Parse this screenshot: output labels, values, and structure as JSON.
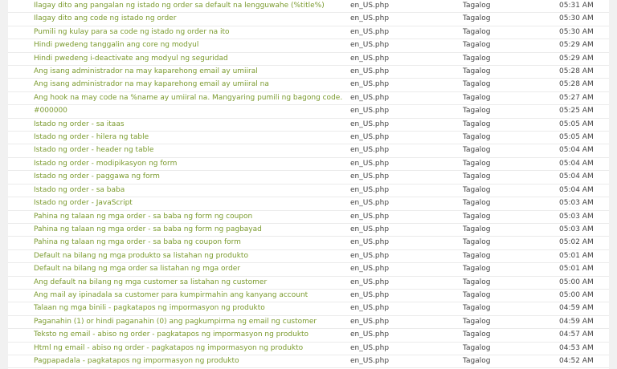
{
  "rows": [
    {
      "text": "Ilagay dito ang pangalan ng istado ng order sa default na lengguwahe (%title%)",
      "file": "en_US.php",
      "language": "Tagalog",
      "time": "05:31 AM"
    },
    {
      "text": "Ilagay dito ang code ng istado ng order",
      "file": "en_US.php",
      "language": "Tagalog",
      "time": "05:30 AM"
    },
    {
      "text": "Pumili ng kulay para sa code ng istado ng order na ito",
      "file": "en_US.php",
      "language": "Tagalog",
      "time": "05:30 AM"
    },
    {
      "text": "Hindi pwedeng tanggalin ang core ng modyul",
      "file": "en_US.php",
      "language": "Tagalog",
      "time": "05:29 AM"
    },
    {
      "text": "Hindi pwedeng i-deactivate ang modyul ng seguridad",
      "file": "en_US.php",
      "language": "Tagalog",
      "time": "05:29 AM"
    },
    {
      "text": "Ang isang administrador na may kaparehong email ay umiiral",
      "file": "en_US.php",
      "language": "Tagalog",
      "time": "05:28 AM"
    },
    {
      "text": "Ang isang administrador na may kaparehong email ay umiiral na",
      "file": "en_US.php",
      "language": "Tagalog",
      "time": "05:28 AM"
    },
    {
      "text": "Ang hook na may code na %name ay umiiral na. Mangyaring pumili ng bagong code.",
      "file": "en_US.php",
      "language": "Tagalog",
      "time": "05:27 AM"
    },
    {
      "text": "#000000",
      "file": "en_US.php",
      "language": "Tagalog",
      "time": "05:25 AM"
    },
    {
      "text": "Istado ng order - sa itaas",
      "file": "en_US.php",
      "language": "Tagalog",
      "time": "05:05 AM"
    },
    {
      "text": "Istado ng order - hilera ng table",
      "file": "en_US.php",
      "language": "Tagalog",
      "time": "05:05 AM"
    },
    {
      "text": "Istado ng order - header ng table",
      "file": "en_US.php",
      "language": "Tagalog",
      "time": "05:04 AM"
    },
    {
      "text": "Istado ng order - modipikasyon ng form",
      "file": "en_US.php",
      "language": "Tagalog",
      "time": "05:04 AM"
    },
    {
      "text": "Istado ng order - paggawa ng form",
      "file": "en_US.php",
      "language": "Tagalog",
      "time": "05:04 AM"
    },
    {
      "text": "Istado ng order - sa baba",
      "file": "en_US.php",
      "language": "Tagalog",
      "time": "05:04 AM"
    },
    {
      "text": "Istado ng order - JavaScript",
      "file": "en_US.php",
      "language": "Tagalog",
      "time": "05:03 AM"
    },
    {
      "text": "Pahina ng talaan ng mga order - sa baba ng form ng coupon",
      "file": "en_US.php",
      "language": "Tagalog",
      "time": "05:03 AM"
    },
    {
      "text": "Pahina ng talaan ng mga order - sa baba ng form ng pagbayad",
      "file": "en_US.php",
      "language": "Tagalog",
      "time": "05:03 AM"
    },
    {
      "text": "Pahina ng talaan ng mga order - sa baba ng coupon form",
      "file": "en_US.php",
      "language": "Tagalog",
      "time": "05:02 AM"
    },
    {
      "text": "Default na bilang ng mga produkto sa listahan ng produkto",
      "file": "en_US.php",
      "language": "Tagalog",
      "time": "05:01 AM"
    },
    {
      "text": "Default na bilang ng mga order sa listahan ng mga order",
      "file": "en_US.php",
      "language": "Tagalog",
      "time": "05:01 AM"
    },
    {
      "text": "Ang default na bilang ng mga customer sa listahan ng customer",
      "file": "en_US.php",
      "language": "Tagalog",
      "time": "05:00 AM"
    },
    {
      "text": "Ang mail ay ipinadala sa customer para kumpirmahin ang kanyang account",
      "file": "en_US.php",
      "language": "Tagalog",
      "time": "05:00 AM"
    },
    {
      "text": "Talaan ng mga binili - pagkatapos ng impormasyon ng produkto",
      "file": "en_US.php",
      "language": "Tagalog",
      "time": "04:59 AM"
    },
    {
      "text": "Paganahin (1) or hindi paganahin (0) ang pagkumpirma ng email ng customer",
      "file": "en_US.php",
      "language": "Tagalog",
      "time": "04:59 AM"
    },
    {
      "text": "Teksto ng email - abiso ng order - pagkatapos ng impormasyon ng produkto",
      "file": "en_US.php",
      "language": "Tagalog",
      "time": "04:57 AM"
    },
    {
      "text": "Html ng email - abiso ng order - pagkatapos ng impormasyon ng produkto",
      "file": "en_US.php",
      "language": "Tagalog",
      "time": "04:53 AM"
    },
    {
      "text": "Pagpapadala - pagkatapos ng impormasyon ng produkto",
      "file": "en_US.php",
      "language": "Tagalog",
      "time": "04:52 AM"
    }
  ]
}
